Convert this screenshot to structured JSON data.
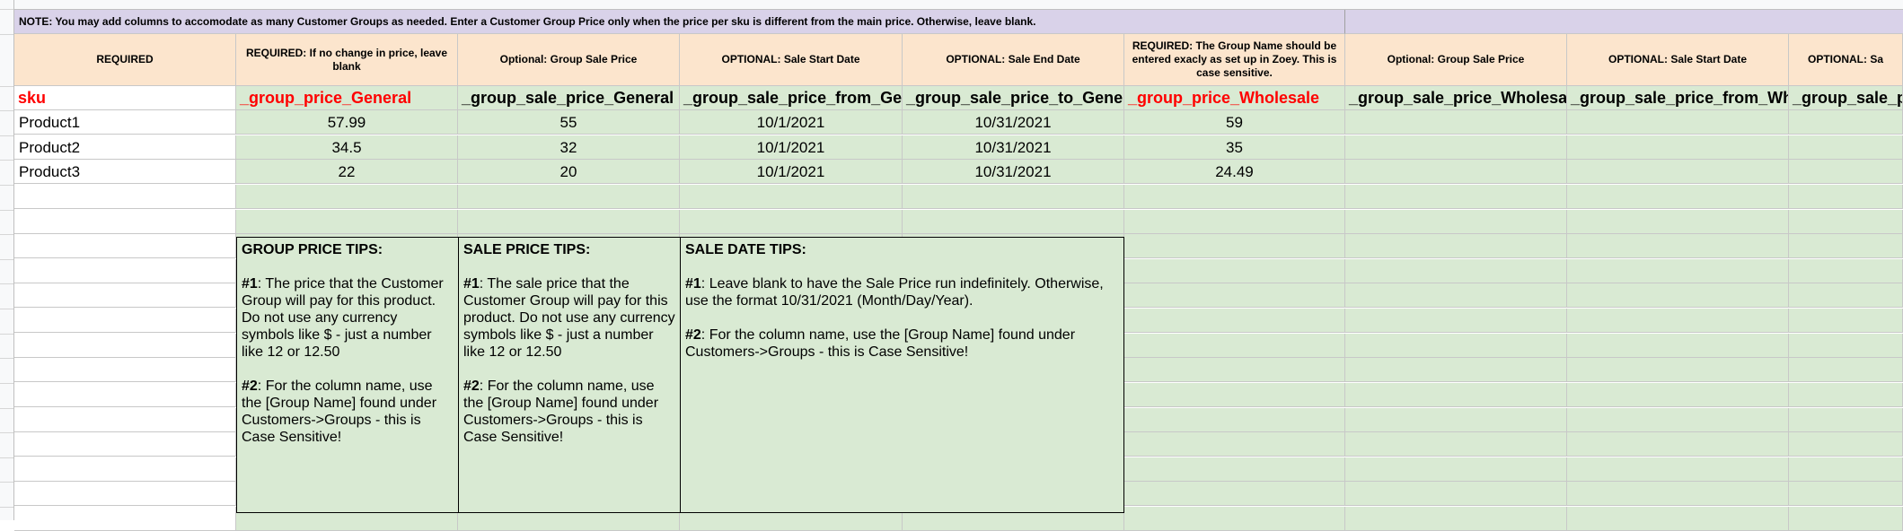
{
  "note": "NOTE: You may add columns to accomodate as many Customer Groups as needed. Enter a Customer Group Price only when the price per sku is different from the main price. Otherwise, leave blank.",
  "headers": [
    "REQUIRED",
    "REQUIRED: If no change in price, leave blank",
    "Optional: Group Sale Price",
    "OPTIONAL: Sale Start Date",
    "OPTIONAL: Sale End Date",
    "REQUIRED: The Group Name should be entered exacly as set up in Zoey. This is case sensitive.",
    "Optional: Group Sale Price",
    "OPTIONAL: Sale Start Date",
    "OPTIONAL: Sa"
  ],
  "fields": [
    "sku",
    "_group_price_General",
    "_group_sale_price_General",
    "_group_sale_price_from_General",
    "_group_sale_price_to_General",
    "_group_price_Wholesale",
    "_group_sale_price_Wholesale",
    "_group_sale_price_from_Wholesale",
    "_group_sale_price_to_Wholesale"
  ],
  "rows": [
    [
      "Product1",
      "57.99",
      "55",
      "10/1/2021",
      "10/31/2021",
      "59"
    ],
    [
      "Product2",
      "34.5",
      "32",
      "10/1/2021",
      "10/31/2021",
      "35"
    ],
    [
      "Product3",
      "22",
      "20",
      "10/1/2021",
      "10/31/2021",
      "24.49"
    ]
  ],
  "tips": {
    "group": {
      "title": "GROUP PRICE TIPS:",
      "t1_label": "#1",
      "t1": ": The price that the Customer Group will pay for this product. Do not use any currency symbols like $ - just a number like 12 or 12.50",
      "t2_label": "#2",
      "t2": ": For the column name, use the [Group Name] found under Customers->Groups - this is Case Sensitive!"
    },
    "sale": {
      "title": "SALE PRICE TIPS:",
      "t1_label": "#1",
      "t1": ": The sale price that the Customer Group will pay for this product. Do not use any currency symbols like $ - just a number like 12 or 12.50",
      "t2_label": "#2",
      "t2": ": For the column name, use the [Group Name] found under Customers->Groups - this is Case Sensitive!"
    },
    "date": {
      "title": "SALE DATE TIPS:",
      "t1_label": "#1",
      "t1": ": Leave blank to have the Sale Price run indefinitely. Otherwise, use the format 10/31/2021 (Month/Day/Year).",
      "t2_label": "#2",
      "t2": ": For the column name, use the [Group Name] found under Customers->Groups - this is Case Sensitive!"
    }
  },
  "colors": {
    "note_bg": "#d9d2e9",
    "header_bg": "#fce5cd",
    "data_bg": "#d9ead3",
    "required_field": "#ff0000"
  }
}
